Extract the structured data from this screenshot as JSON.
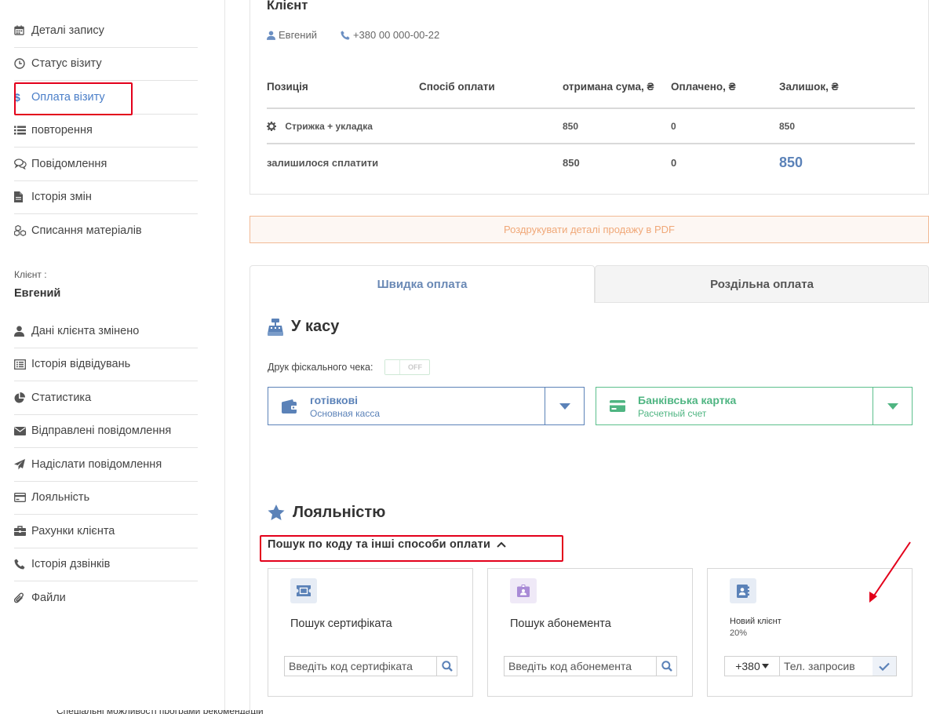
{
  "sidebar": {
    "items_top": [
      {
        "label": "Деталі запису",
        "icon": "calendar-icon"
      },
      {
        "label": "Статус візиту",
        "icon": "clock-icon"
      },
      {
        "label": "Оплата візиту",
        "icon": "dollar-icon",
        "active": true
      },
      {
        "label": "повторення",
        "icon": "list-icon"
      },
      {
        "label": "Повідомлення",
        "icon": "chat-icon"
      },
      {
        "label": "Історія змін",
        "icon": "file-icon"
      },
      {
        "label": "Списання матеріалів",
        "icon": "cubes-icon"
      }
    ],
    "client_caption": "Клієнт :",
    "client_name": "Евгений",
    "items_client": [
      {
        "label": "Дані клієнта змінено",
        "icon": "user-icon"
      },
      {
        "label": "Історія відвідувань",
        "icon": "list-alt-icon"
      },
      {
        "label": "Статистика",
        "icon": "pie-chart-icon"
      },
      {
        "label": "Відправлені повідомлення",
        "icon": "envelope-icon"
      },
      {
        "label": "Надіслати повідомлення",
        "icon": "paper-plane-icon"
      },
      {
        "label": "Лояльність",
        "icon": "credit-card-icon"
      },
      {
        "label": "Рахунки клієнта",
        "icon": "briefcase-icon"
      },
      {
        "label": "Історія дзвінків",
        "icon": "phone-icon"
      },
      {
        "label": "Файли",
        "icon": "paperclip-icon"
      }
    ],
    "bottom_cut_text": "Спеціальні можливості програми рекомендацій"
  },
  "client": {
    "title": "Клієнт",
    "name": "Евгений",
    "phone": "+380 00 000-00-22"
  },
  "payment_table": {
    "headers": [
      "Позиція",
      "Спосіб оплати",
      "отримана сума, ₴",
      "Оплачено, ₴",
      "Залишок, ₴"
    ],
    "rows": [
      {
        "position": "Стрижка + укладка",
        "method": "",
        "received": "850",
        "paid": "0",
        "remaining": "850"
      }
    ],
    "total": {
      "label": "залишилося сплатити",
      "received": "850",
      "paid": "0",
      "remaining": "850"
    }
  },
  "pdf_button": "Роздрукувати деталі продажу в PDF",
  "tabs": {
    "quick": "Швидка оплата",
    "split": "Роздільна оплата"
  },
  "cashier": {
    "title": "У касу",
    "fiscal_label": "Друк фіскального чека:",
    "fiscal_toggle": "OFF",
    "cash": {
      "title": "готівкові",
      "sub": "Основная касса"
    },
    "card": {
      "title": "Банківська картка",
      "sub": "Расчетный счет"
    }
  },
  "loyalty": {
    "title": "Лояльністю",
    "search_toggle": "Пошук по коду та інші способи оплати",
    "certificate": {
      "title": "Пошук сертифіката",
      "placeholder": "Введіть код сертифіката"
    },
    "subscription": {
      "title": "Пошук абонемента",
      "placeholder": "Введіть код абонемента"
    },
    "new_client": {
      "title": "Новий клієнт",
      "percent": "20%",
      "phone_code": "+380",
      "placeholder": "Тел. запросив"
    }
  },
  "colors": {
    "accent_blue": "#5b82b8",
    "accent_green": "#4fb582",
    "highlight_red": "#e3001b",
    "pdf_orange": "#f0a878"
  }
}
